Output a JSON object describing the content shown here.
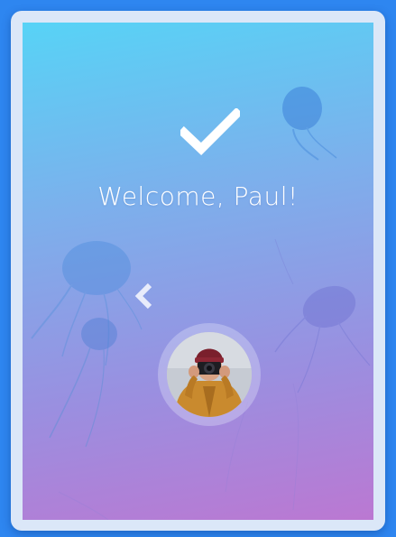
{
  "welcome": {
    "text": "Welcome, Paul!"
  },
  "icons": {
    "success": "checkmark-icon",
    "previous": "chevron-left-icon",
    "background": "jellyfish-background"
  },
  "user": {
    "avatar": "user-avatar-photo"
  },
  "colors": {
    "gradient_top": "#57d3f6",
    "gradient_bottom": "#bb78d2",
    "page_background": "#2e86f0",
    "frame": "#dbe7f8"
  }
}
